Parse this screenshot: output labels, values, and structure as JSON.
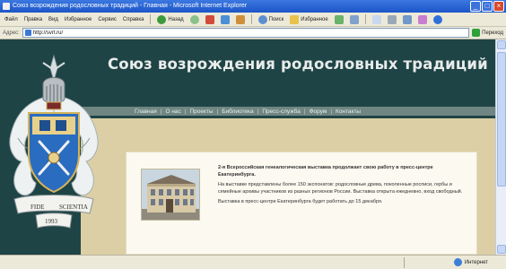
{
  "window": {
    "title": "Союз возрождения родословных традиций - Главная - Microsoft Internet Explorer",
    "controls": {
      "minimize": "_",
      "maximize": "□",
      "close": "×"
    }
  },
  "menubar": {
    "items": [
      "Файл",
      "Правка",
      "Вид",
      "Избранное",
      "Сервис",
      "Справка"
    ],
    "toolbar": {
      "back_label": "Назад",
      "search_label": "Поиск",
      "favorites_label": "Избранное"
    }
  },
  "addressbar": {
    "label": "Адрес:",
    "url": "http://svrt.ru/",
    "go_label": "Переход"
  },
  "site": {
    "title": "Союз возрождения родословных традиций",
    "nav": [
      "Главная",
      "О нас",
      "Проекты",
      "Библиотека",
      "Пресс-служба",
      "Форум",
      "Контакты"
    ],
    "crest_motto": [
      "FIDE",
      "SCIENTIA",
      "1993"
    ],
    "news": {
      "paragraphs": [
        "2-я Всероссийская генеалогическая выставка продолжает свою работу в пресс-центре Екатеринбурга.",
        "На выставке представлены более 150 экспонатов: родословные древа, поколенные росписи, гербы и семейные архивы участников из разных регионов России. Выставка открыта ежедневно, вход свободный.",
        "Выставка в пресс-центре Екатеринбурга будет работать до 15 декабря."
      ]
    }
  },
  "status": {
    "zone": "Интернет"
  },
  "colors": {
    "header_bg": "#1f4446",
    "nav_bg": "#6f8682",
    "body_bg": "#dccfa5",
    "card_bg": "#fbf9f0",
    "titlebar": "#1c55c8"
  }
}
